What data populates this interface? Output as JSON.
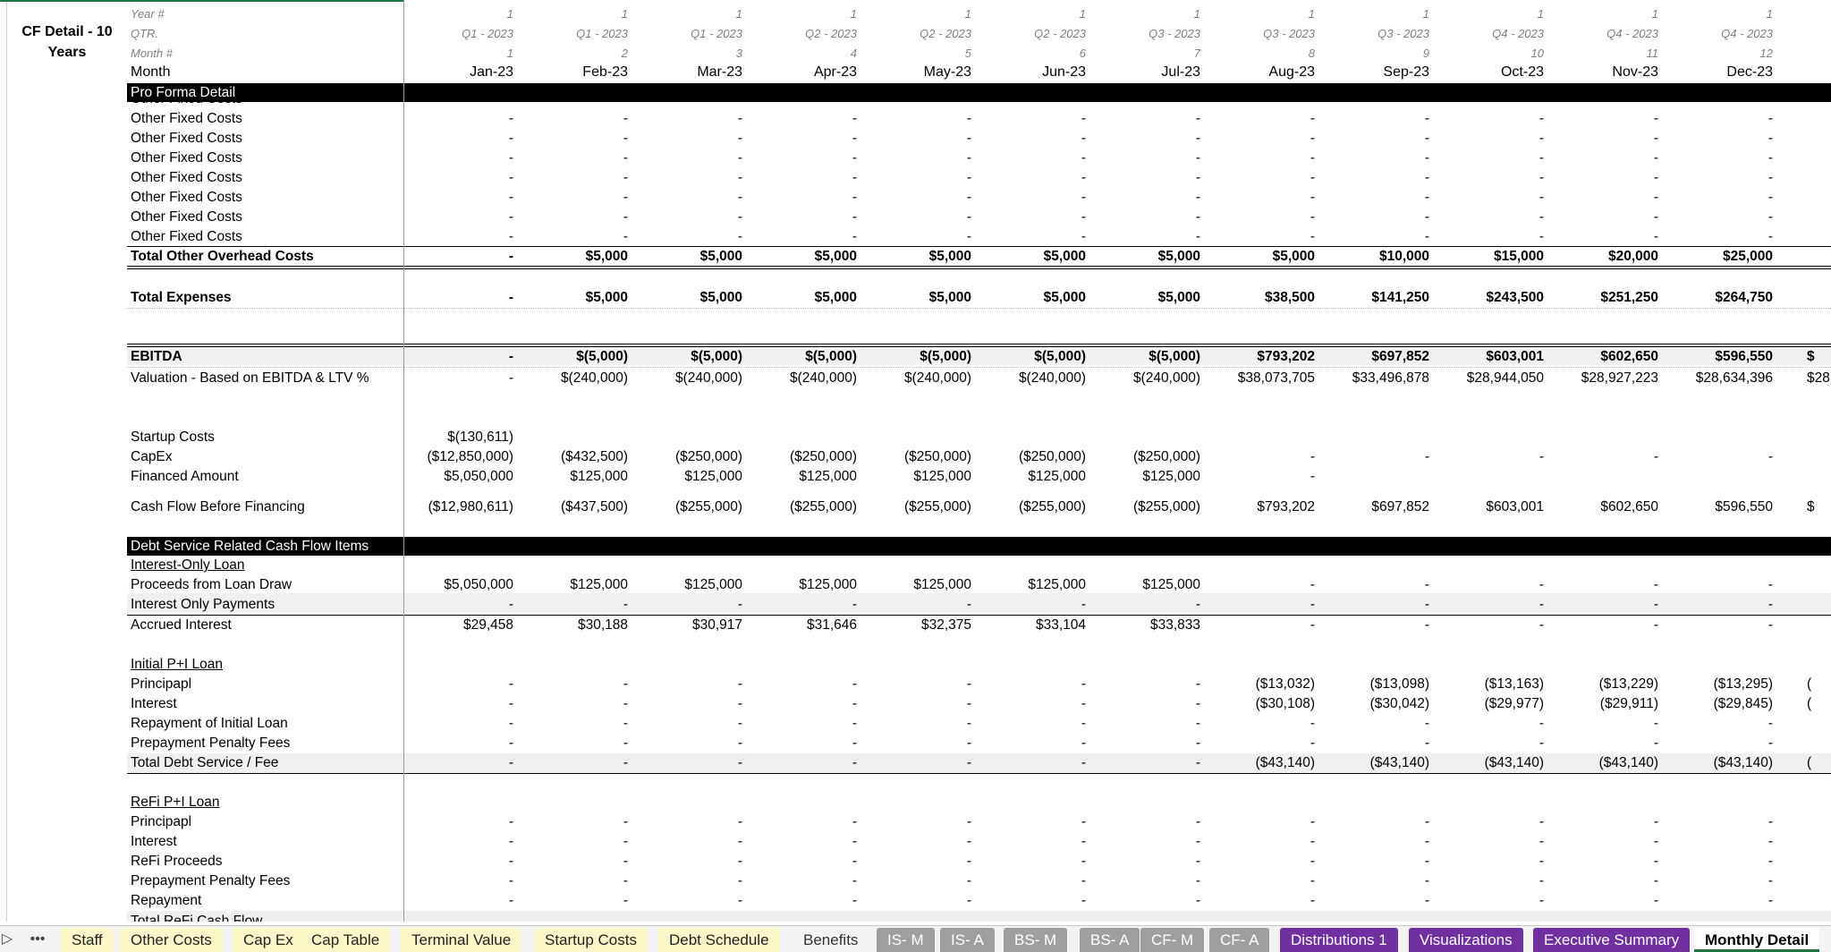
{
  "sheet": {
    "title_line1": "CF Detail - 10",
    "title_line2": "Years"
  },
  "header": {
    "year_label": "Year #",
    "qtr_label": "QTR.",
    "monthnum_label": "Month #",
    "month_label": "Month",
    "years": [
      "1",
      "1",
      "1",
      "1",
      "1",
      "1",
      "1",
      "1",
      "1",
      "1",
      "1",
      "1"
    ],
    "quarters": [
      "Q1 - 2023",
      "Q1 - 2023",
      "Q1 - 2023",
      "Q2 - 2023",
      "Q2 - 2023",
      "Q2 - 2023",
      "Q3 - 2023",
      "Q3 - 2023",
      "Q3 - 2023",
      "Q4 - 2023",
      "Q4 - 2023",
      "Q4 - 2023"
    ],
    "month_numbers": [
      "1",
      "2",
      "3",
      "4",
      "5",
      "6",
      "7",
      "8",
      "9",
      "10",
      "11",
      "12"
    ],
    "months": [
      "Jan-23",
      "Feb-23",
      "Mar-23",
      "Apr-23",
      "May-23",
      "Jun-23",
      "Jul-23",
      "Aug-23",
      "Sep-23",
      "Oct-23",
      "Nov-23",
      "Dec-23"
    ]
  },
  "sections": {
    "pro_forma": "Pro Forma Detail",
    "debt_service": "Debt Service Related Cash Flow Items"
  },
  "rows": {
    "cut_top": "Other Fixed Costs",
    "ofc1": {
      "label": "Other Fixed Costs",
      "values": [
        "-",
        "-",
        "-",
        "-",
        "-",
        "-",
        "-",
        "-",
        "-",
        "-",
        "-",
        "-"
      ]
    },
    "ofc2": {
      "label": "Other Fixed Costs",
      "values": [
        "-",
        "-",
        "-",
        "-",
        "-",
        "-",
        "-",
        "-",
        "-",
        "-",
        "-",
        "-"
      ]
    },
    "ofc3": {
      "label": "Other Fixed Costs",
      "values": [
        "-",
        "-",
        "-",
        "-",
        "-",
        "-",
        "-",
        "-",
        "-",
        "-",
        "-",
        "-"
      ]
    },
    "ofc4": {
      "label": "Other Fixed Costs",
      "values": [
        "-",
        "-",
        "-",
        "-",
        "-",
        "-",
        "-",
        "-",
        "-",
        "-",
        "-",
        "-"
      ]
    },
    "ofc5": {
      "label": "Other Fixed Costs",
      "values": [
        "-",
        "-",
        "-",
        "-",
        "-",
        "-",
        "-",
        "-",
        "-",
        "-",
        "-",
        "-"
      ]
    },
    "ofc6": {
      "label": "Other Fixed Costs",
      "values": [
        "-",
        "-",
        "-",
        "-",
        "-",
        "-",
        "-",
        "-",
        "-",
        "-",
        "-",
        "-"
      ]
    },
    "ofc7": {
      "label": "Other Fixed Costs",
      "values": [
        "-",
        "-",
        "-",
        "-",
        "-",
        "-",
        "-",
        "-",
        "-",
        "-",
        "-",
        "-"
      ]
    },
    "total_overhead": {
      "label": "Total Other Overhead Costs",
      "values": [
        "-",
        "$5,000",
        "$5,000",
        "$5,000",
        "$5,000",
        "$5,000",
        "$5,000",
        "$5,000",
        "$10,000",
        "$15,000",
        "$20,000",
        "$25,000"
      ]
    },
    "total_expenses": {
      "label": "Total Expenses",
      "values": [
        "-",
        "$5,000",
        "$5,000",
        "$5,000",
        "$5,000",
        "$5,000",
        "$5,000",
        "$38,500",
        "$141,250",
        "$243,500",
        "$251,250",
        "$264,750"
      ]
    },
    "ebitda": {
      "label": "EBITDA",
      "values": [
        "-",
        "$(5,000)",
        "$(5,000)",
        "$(5,000)",
        "$(5,000)",
        "$(5,000)",
        "$(5,000)",
        "$793,202",
        "$697,852",
        "$603,001",
        "$602,650",
        "$596,550"
      ],
      "overflow": "$"
    },
    "valuation": {
      "label": "Valuation - Based on EBITDA & LTV %",
      "values": [
        "-",
        "$(240,000)",
        "$(240,000)",
        "$(240,000)",
        "$(240,000)",
        "$(240,000)",
        "$(240,000)",
        "$38,073,705",
        "$33,496,878",
        "$28,944,050",
        "$28,927,223",
        "$28,634,396"
      ],
      "overflow": "$28,"
    },
    "startup": {
      "label": "Startup Costs",
      "values": [
        "$(130,611)",
        "",
        "",
        "",
        "",
        "",
        "",
        "",
        "",
        "",
        "",
        ""
      ]
    },
    "capex": {
      "label": "CapEx",
      "values": [
        "($12,850,000)",
        "($432,500)",
        "($250,000)",
        "($250,000)",
        "($250,000)",
        "($250,000)",
        "($250,000)",
        "-",
        "-",
        "-",
        "-",
        "-"
      ]
    },
    "financed": {
      "label": "Financed Amount",
      "values": [
        "$5,050,000",
        "$125,000",
        "$125,000",
        "$125,000",
        "$125,000",
        "$125,000",
        "$125,000",
        "-",
        "",
        "",
        "",
        ""
      ]
    },
    "cfbf": {
      "label": "Cash Flow Before Financing",
      "values": [
        "($12,980,611)",
        "($437,500)",
        "($255,000)",
        "($255,000)",
        "($255,000)",
        "($255,000)",
        "($255,000)",
        "$793,202",
        "$697,852",
        "$603,001",
        "$602,650",
        "$596,550"
      ],
      "overflow": "$"
    },
    "io_loan": "Interest-Only Loan",
    "proceeds": {
      "label": "Proceeds from Loan Draw",
      "values": [
        "$5,050,000",
        "$125,000",
        "$125,000",
        "$125,000",
        "$125,000",
        "$125,000",
        "$125,000",
        "-",
        "-",
        "-",
        "-",
        "-"
      ]
    },
    "io_payments": {
      "label": "Interest Only Payments",
      "values": [
        "-",
        "-",
        "-",
        "-",
        "-",
        "-",
        "-",
        "-",
        "-",
        "-",
        "-",
        "-"
      ]
    },
    "accrued": {
      "label": "Accrued Interest",
      "values": [
        "$29,458",
        "$30,188",
        "$30,917",
        "$31,646",
        "$32,375",
        "$33,104",
        "$33,833",
        "-",
        "-",
        "-",
        "-",
        "-"
      ]
    },
    "initial_loan": "Initial P+I Loan",
    "principal1": {
      "label": "Principapl",
      "values": [
        "-",
        "-",
        "-",
        "-",
        "-",
        "-",
        "-",
        "($13,032)",
        "($13,098)",
        "($13,163)",
        "($13,229)",
        "($13,295)"
      ],
      "overflow": "("
    },
    "interest1": {
      "label": "Interest",
      "values": [
        "-",
        "-",
        "-",
        "-",
        "-",
        "-",
        "-",
        "($30,108)",
        "($30,042)",
        "($29,977)",
        "($29,911)",
        "($29,845)"
      ],
      "overflow": "("
    },
    "repay_initial": {
      "label": "Repayment of Initial Loan",
      "values": [
        "-",
        "-",
        "-",
        "-",
        "-",
        "-",
        "-",
        "-",
        "-",
        "-",
        "-",
        "-"
      ]
    },
    "prepay1": {
      "label": "Prepayment Penalty Fees",
      "values": [
        "-",
        "-",
        "-",
        "-",
        "-",
        "-",
        "-",
        "-",
        "-",
        "-",
        "-",
        "-"
      ]
    },
    "total_debt": {
      "label": "Total Debt Service / Fee",
      "values": [
        "-",
        "-",
        "-",
        "-",
        "-",
        "-",
        "-",
        "($43,140)",
        "($43,140)",
        "($43,140)",
        "($43,140)",
        "($43,140)"
      ],
      "overflow": "("
    },
    "refi_loan": "ReFi P+I Loan",
    "principal2": {
      "label": "Principapl",
      "values": [
        "-",
        "-",
        "-",
        "-",
        "-",
        "-",
        "-",
        "-",
        "-",
        "-",
        "-",
        "-"
      ]
    },
    "interest2": {
      "label": "Interest",
      "values": [
        "-",
        "-",
        "-",
        "-",
        "-",
        "-",
        "-",
        "-",
        "-",
        "-",
        "-",
        "-"
      ]
    },
    "refi_proceeds": {
      "label": "ReFi Proceeds",
      "values": [
        "-",
        "-",
        "-",
        "-",
        "-",
        "-",
        "-",
        "-",
        "-",
        "-",
        "-",
        "-"
      ]
    },
    "prepay2": {
      "label": "Prepayment Penalty Fees",
      "values": [
        "-",
        "-",
        "-",
        "-",
        "-",
        "-",
        "-",
        "-",
        "-",
        "-",
        "-",
        "-"
      ]
    },
    "repayment": {
      "label": "Repayment",
      "values": [
        "-",
        "-",
        "-",
        "-",
        "-",
        "-",
        "-",
        "-",
        "-",
        "-",
        "-",
        "-"
      ]
    },
    "total_refi": "Total ReFi Cash Flow"
  },
  "tabs": {
    "nav_prev": "▷",
    "nav_more": "•••",
    "items": [
      {
        "label": "Staff",
        "style": "yellow"
      },
      {
        "label": "Other Costs",
        "style": "yellow"
      },
      {
        "label": "Cap Ex",
        "style": "yellow"
      },
      {
        "label": "Cap Table",
        "style": "yellow"
      },
      {
        "label": "Terminal Value",
        "style": "yellow"
      },
      {
        "label": "Startup Costs",
        "style": "yellow"
      },
      {
        "label": "Debt Schedule",
        "style": "yellow"
      },
      {
        "label": "Benefits",
        "style": "plain"
      },
      {
        "label": "IS- M",
        "style": "gray"
      },
      {
        "label": "IS- A",
        "style": "gray"
      },
      {
        "label": "BS- M",
        "style": "gray"
      },
      {
        "label": "BS- A",
        "style": "gray"
      },
      {
        "label": "CF- M",
        "style": "gray"
      },
      {
        "label": "CF- A",
        "style": "gray"
      },
      {
        "label": "Distributions 1",
        "style": "purple"
      },
      {
        "label": "Visualizations",
        "style": "purple"
      },
      {
        "label": "Executive Summary",
        "style": "purple"
      },
      {
        "label": "Monthly Detail",
        "style": "active"
      }
    ]
  }
}
